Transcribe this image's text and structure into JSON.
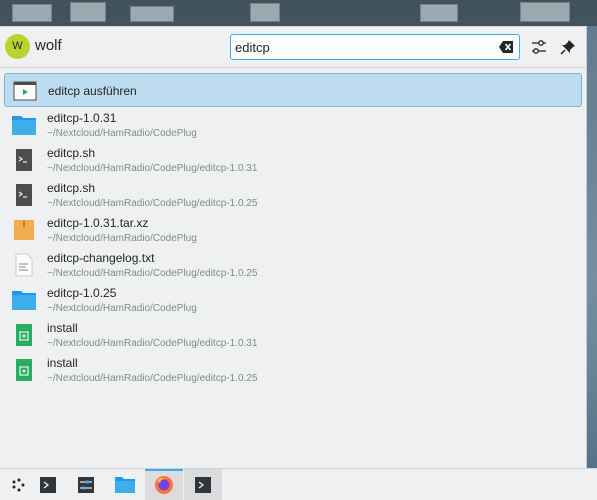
{
  "user": {
    "initial": "W",
    "name": "wolf"
  },
  "search": {
    "value": "editcp",
    "placeholder": ""
  },
  "results": [
    {
      "title": "editcp ausführen",
      "subtitle": "",
      "icon": "run-command-icon"
    },
    {
      "title": "editcp-1.0.31",
      "subtitle": "~/Nextcloud/HamRadio/CodePlug",
      "icon": "folder-icon"
    },
    {
      "title": "editcp.sh",
      "subtitle": "~/Nextcloud/HamRadio/CodePlug/editcp-1.0.31",
      "icon": "shell-script-icon"
    },
    {
      "title": "editcp.sh",
      "subtitle": "~/Nextcloud/HamRadio/CodePlug/editcp-1.0.25",
      "icon": "shell-script-icon"
    },
    {
      "title": "editcp-1.0.31.tar.xz",
      "subtitle": "~/Nextcloud/HamRadio/CodePlug",
      "icon": "archive-icon"
    },
    {
      "title": "editcp-changelog.txt",
      "subtitle": "~/Nextcloud/HamRadio/CodePlug/editcp-1.0.25",
      "icon": "text-file-icon"
    },
    {
      "title": "editcp-1.0.25",
      "subtitle": "~/Nextcloud/HamRadio/CodePlug",
      "icon": "folder-icon"
    },
    {
      "title": "install",
      "subtitle": "~/Nextcloud/HamRadio/CodePlug/editcp-1.0.31",
      "icon": "executable-icon"
    },
    {
      "title": "install",
      "subtitle": "~/Nextcloud/HamRadio/CodePlug/editcp-1.0.25",
      "icon": "executable-icon"
    }
  ],
  "taskbar": [
    "app-launcher-icon",
    "terminal-icon",
    "system-settings-icon",
    "file-manager-icon",
    "firefox-icon",
    "terminal-icon"
  ],
  "colors": {
    "accent": "#3daee9",
    "selection": "#bddcef",
    "folder": "#3daee9",
    "archive": "#f0ad4e",
    "executable": "#27ae60"
  }
}
